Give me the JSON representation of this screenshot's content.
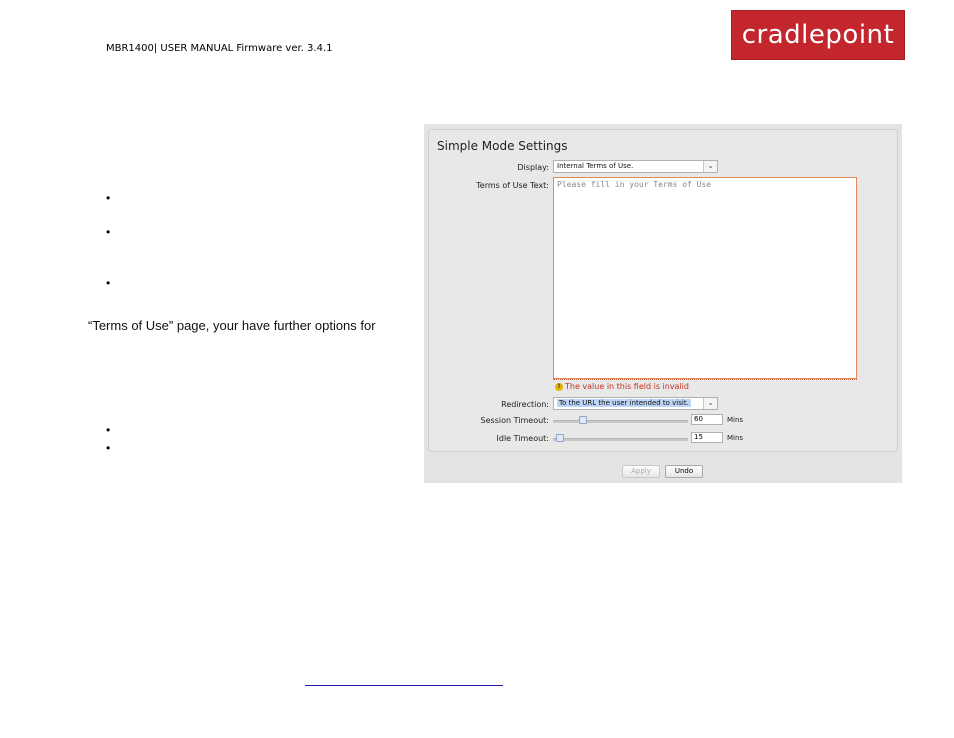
{
  "header": {
    "manual_title": "MBR1400| USER MANUAL Firmware ver. 3.4.1",
    "logo_text": "cradlepoint"
  },
  "body": {
    "bullet_char": "•",
    "text_line": "“Terms of Use” page, your have further options for"
  },
  "settings": {
    "title": "Simple Mode Settings",
    "display_label": "Display:",
    "display_value": "Internal Terms of Use.",
    "terms_label": "Terms of Use Text:",
    "terms_placeholder": "Please fill in your Terms of Use",
    "error_icon": "!",
    "error_text": "The value in this field is invalid",
    "redirection_label": "Redirection:",
    "redirection_value": "To the URL the user intended to visit.",
    "session_label": "Session Timeout:",
    "session_value": "60",
    "idle_label": "Idle Timeout:",
    "idle_value": "15",
    "unit": "Mins",
    "apply_label": "Apply",
    "undo_label": "Undo",
    "dropdown_arrow": "⌄"
  },
  "colors": {
    "logo_bg": "#c4262e",
    "error": "#c8321e"
  }
}
